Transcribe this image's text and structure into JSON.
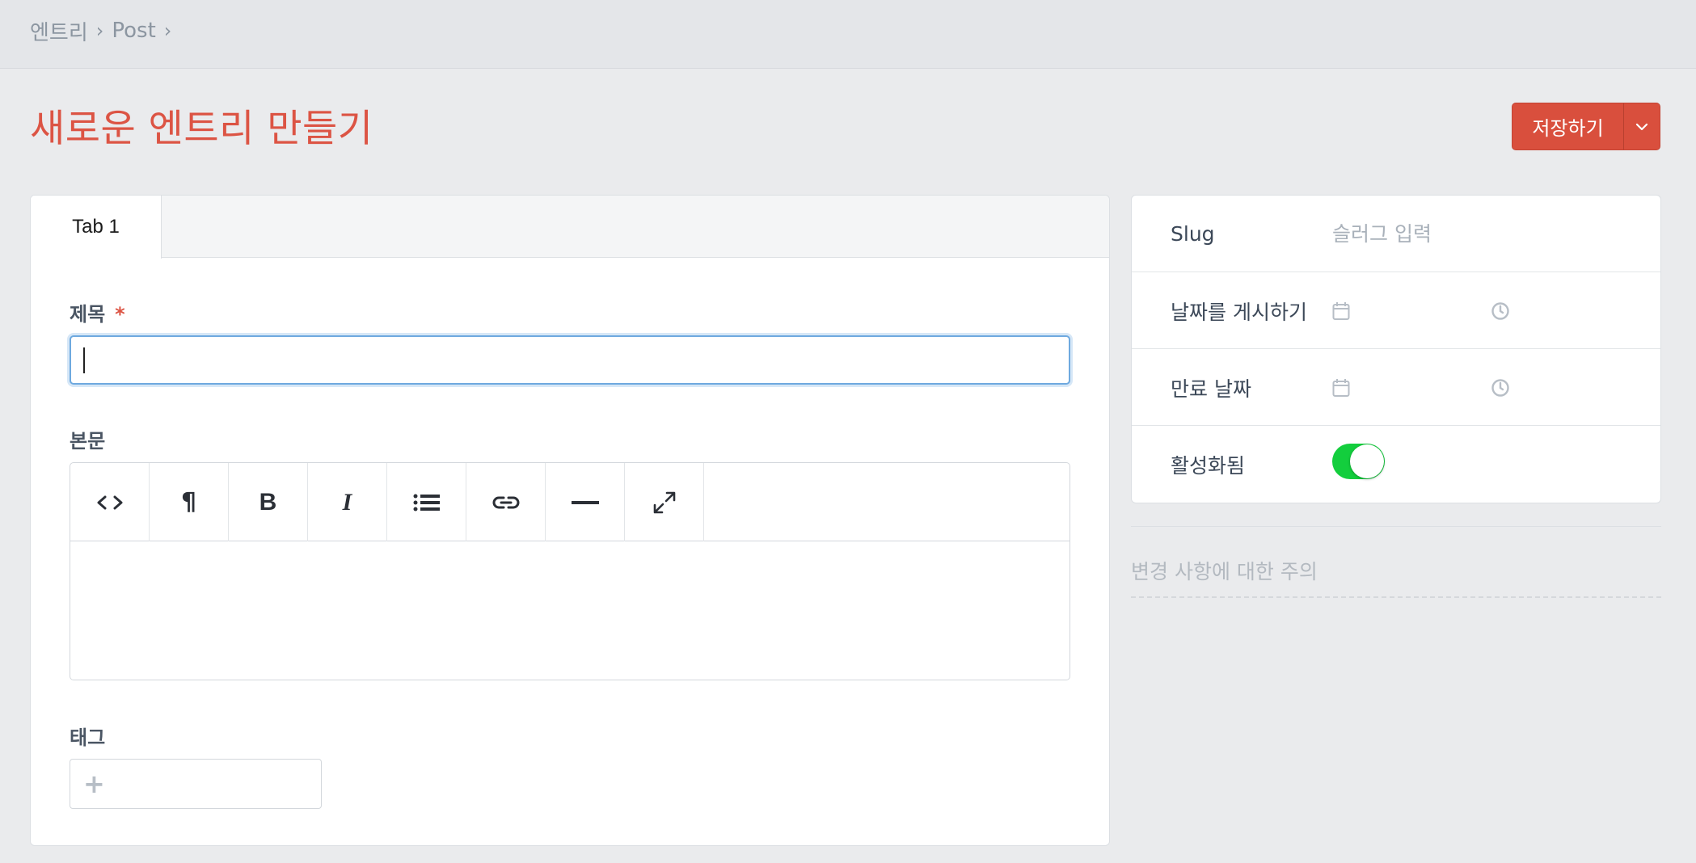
{
  "breadcrumb": {
    "items": [
      "엔트리",
      "Post"
    ],
    "separator": "›"
  },
  "page": {
    "title": "새로운 엔트리 만들기"
  },
  "actions": {
    "save_label": "저장하기",
    "accent": "#dc5444"
  },
  "tabs": [
    {
      "label": "Tab 1"
    }
  ],
  "fields": {
    "title": {
      "label": "제목",
      "required_mark": "*",
      "value": ""
    },
    "body": {
      "label": "본문",
      "toolbar": [
        "code-icon",
        "paragraph-icon",
        "bold-icon",
        "italic-icon",
        "list-icon",
        "link-icon",
        "horizontal-rule-icon",
        "fullscreen-icon"
      ]
    },
    "tags": {
      "label": "태그",
      "add_symbol": "+"
    }
  },
  "sidebar": {
    "slug": {
      "label": "Slug",
      "placeholder": "슬러그 입력"
    },
    "publish_date": {
      "label": "날짜를 게시하기"
    },
    "expiry_date": {
      "label": "만료 날짜"
    },
    "enabled": {
      "label": "활성화됨",
      "value": true,
      "color": "#13ce3d"
    },
    "notes": {
      "placeholder": "변경 사항에 대한 주의"
    }
  }
}
